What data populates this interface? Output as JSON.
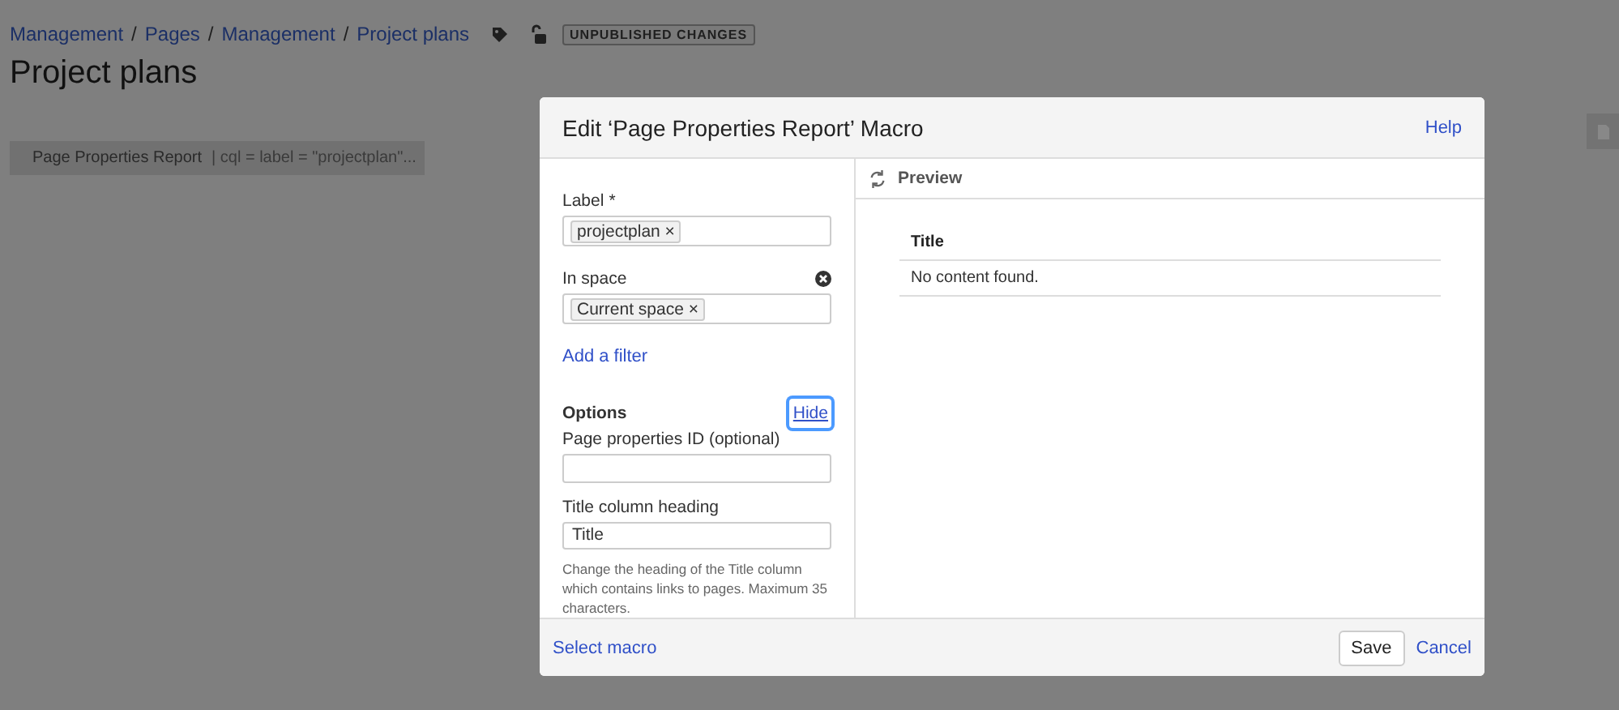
{
  "breadcrumbs": [
    "Management",
    "Pages",
    "Management",
    "Project plans"
  ],
  "breadcrumb_separator": "/",
  "status_badge": "UNPUBLISHED CHANGES",
  "page_title": "Project plans",
  "macro_placeholder": {
    "name": "Page Properties Report",
    "params": "| cql = label = \"projectplan\"..."
  },
  "dialog": {
    "title": "Edit ‘Page Properties Report’ Macro",
    "help": "Help",
    "fields": [
      {
        "kind": "tags",
        "label": "Label",
        "required_mark": "*",
        "clearable": false,
        "tags": [
          {
            "label": "projectplan",
            "remove": "×"
          }
        ]
      },
      {
        "kind": "tags",
        "label": "In space",
        "clearable": true,
        "tags": [
          {
            "label": "Current space",
            "remove": "×"
          }
        ]
      }
    ],
    "add_filter": "Add a filter",
    "options": {
      "heading": "Options",
      "toggle": {
        "label": "Hide",
        "focused": true
      },
      "fields": [
        {
          "kind": "text",
          "label": "Page properties ID (optional)"
        },
        {
          "kind": "text",
          "label": "Title column heading",
          "value": "Title",
          "hint": "Change the heading of the Title column which contains links to pages. Maximum 35 characters."
        }
      ]
    },
    "preview": {
      "heading": "Preview",
      "columns": [
        "Title"
      ],
      "empty_message": "No content found."
    },
    "footer": {
      "link": "Select macro",
      "buttons": [
        {
          "label": "Save",
          "kind": "button"
        },
        {
          "label": "Cancel",
          "kind": "link"
        }
      ]
    }
  }
}
